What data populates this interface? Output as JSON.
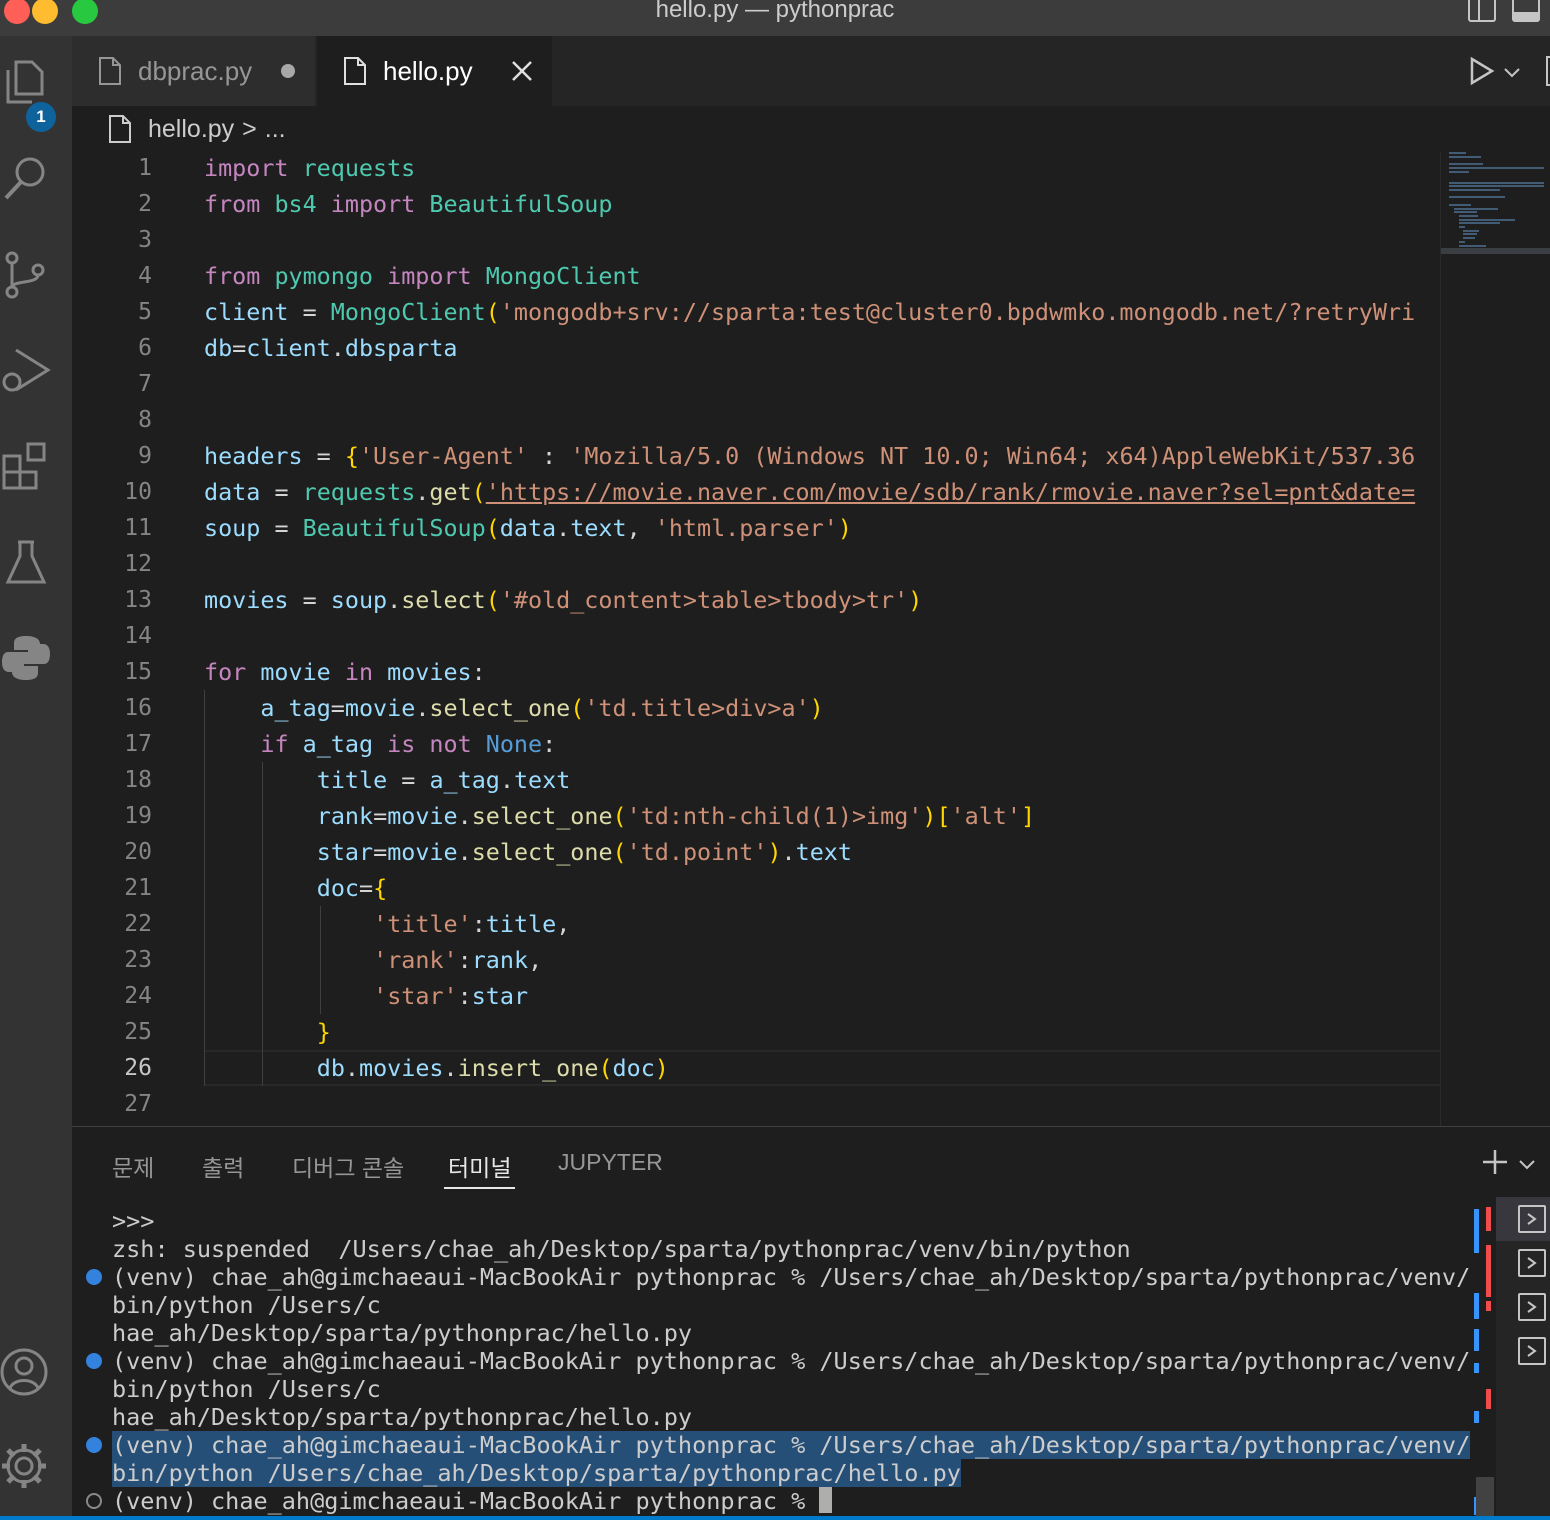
{
  "window": {
    "title": "hello.py — pythonprac"
  },
  "activity_bar": {
    "items": [
      {
        "name": "explorer",
        "icon": "files-icon",
        "badge": "1"
      },
      {
        "name": "search",
        "icon": "search-icon"
      },
      {
        "name": "source-control",
        "icon": "source-control-icon"
      },
      {
        "name": "run-debug",
        "icon": "run-debug-icon"
      },
      {
        "name": "extensions",
        "icon": "extensions-icon"
      },
      {
        "name": "testing",
        "icon": "flask-icon"
      },
      {
        "name": "python",
        "icon": "python-icon"
      }
    ],
    "bottom": [
      {
        "name": "accounts",
        "icon": "account-icon"
      },
      {
        "name": "manage",
        "icon": "gear-icon"
      }
    ]
  },
  "tabs": [
    {
      "label": "dbprac.py",
      "state": "modified",
      "active": false
    },
    {
      "label": "hello.py",
      "state": "saved",
      "active": true
    }
  ],
  "breadcrumb": {
    "file": "hello.py",
    "sep": ">",
    "rest": "..."
  },
  "editor": {
    "current_line": 26,
    "lines": [
      {
        "n": "1",
        "text": "import requests"
      },
      {
        "n": "2",
        "text": "from bs4 import BeautifulSoup"
      },
      {
        "n": "3",
        "text": ""
      },
      {
        "n": "4",
        "text": "from pymongo import MongoClient"
      },
      {
        "n": "5",
        "text": "client = MongoClient('mongodb+srv://sparta:test@cluster0.bpdwmko.mongodb.net/?retryWri"
      },
      {
        "n": "6",
        "text": "db=client.dbsparta"
      },
      {
        "n": "7",
        "text": ""
      },
      {
        "n": "8",
        "text": ""
      },
      {
        "n": "9",
        "text": "headers = {'User-Agent' : 'Mozilla/5.0 (Windows NT 10.0; Win64; x64)AppleWebKit/537.36"
      },
      {
        "n": "10",
        "text": "data = requests.get('https://movie.naver.com/movie/sdb/rank/rmovie.naver?sel=pnt&date="
      },
      {
        "n": "11",
        "text": "soup = BeautifulSoup(data.text, 'html.parser')"
      },
      {
        "n": "12",
        "text": ""
      },
      {
        "n": "13",
        "text": "movies = soup.select('#old_content>table>tbody>tr')"
      },
      {
        "n": "14",
        "text": ""
      },
      {
        "n": "15",
        "text": "for movie in movies:"
      },
      {
        "n": "16",
        "text": "    a_tag=movie.select_one('td.title>div>a')"
      },
      {
        "n": "17",
        "text": "    if a_tag is not None:"
      },
      {
        "n": "18",
        "text": "        title = a_tag.text"
      },
      {
        "n": "19",
        "text": "        rank=movie.select_one('td:nth-child(1)>img')['alt']"
      },
      {
        "n": "20",
        "text": "        star=movie.select_one('td.point').text"
      },
      {
        "n": "21",
        "text": "        doc={"
      },
      {
        "n": "22",
        "text": "            'title':title,"
      },
      {
        "n": "23",
        "text": "            'rank':rank,"
      },
      {
        "n": "24",
        "text": "            'star':star"
      },
      {
        "n": "25",
        "text": "        }"
      },
      {
        "n": "26",
        "text": "        db.movies.insert_one(doc)"
      },
      {
        "n": "27",
        "text": ""
      }
    ]
  },
  "panel": {
    "tabs": [
      {
        "label": "문제",
        "active": false
      },
      {
        "label": "출력",
        "active": false
      },
      {
        "label": "디버그 콘솔",
        "active": false
      },
      {
        "label": "터미널",
        "active": true
      },
      {
        "label": "JUPYTER",
        "active": false
      }
    ],
    "terminal_lines": [
      {
        "text": ">>>",
        "marker": "none",
        "selected": false
      },
      {
        "text": "zsh: suspended  /Users/chae_ah/Desktop/sparta/pythonprac/venv/bin/python",
        "marker": "none",
        "selected": false
      },
      {
        "text": "(venv) chae_ah@gimchaeaui-MacBookAir pythonprac % /Users/chae_ah/Desktop/sparta/pythonprac/venv/",
        "marker": "success",
        "selected": false
      },
      {
        "text": "bin/python /Users/c",
        "marker": "none",
        "selected": false
      },
      {
        "text": "hae_ah/Desktop/sparta/pythonprac/hello.py",
        "marker": "none",
        "selected": false
      },
      {
        "text": "(venv) chae_ah@gimchaeaui-MacBookAir pythonprac % /Users/chae_ah/Desktop/sparta/pythonprac/venv/",
        "marker": "success",
        "selected": false
      },
      {
        "text": "bin/python /Users/c",
        "marker": "none",
        "selected": false
      },
      {
        "text": "hae_ah/Desktop/sparta/pythonprac/hello.py",
        "marker": "none",
        "selected": false
      },
      {
        "text": "(venv) chae_ah@gimchaeaui-MacBookAir pythonprac % /Users/chae_ah/Desktop/sparta/pythonprac/venv/",
        "marker": "success",
        "selected": true
      },
      {
        "text": "bin/python /Users/chae_ah/Desktop/sparta/pythonprac/hello.py",
        "marker": "none",
        "selected": true
      },
      {
        "text": "(venv) chae_ah@gimchaeaui-MacBookAir pythonprac % ",
        "marker": "pending",
        "selected": false
      }
    ],
    "terminal_instances": 4
  },
  "colors": {
    "keyword": "#c586c0",
    "class": "#4ec9b0",
    "function": "#dcdcaa",
    "variable": "#9cdcfe",
    "string": "#ce9178",
    "accent": "#007acc"
  }
}
